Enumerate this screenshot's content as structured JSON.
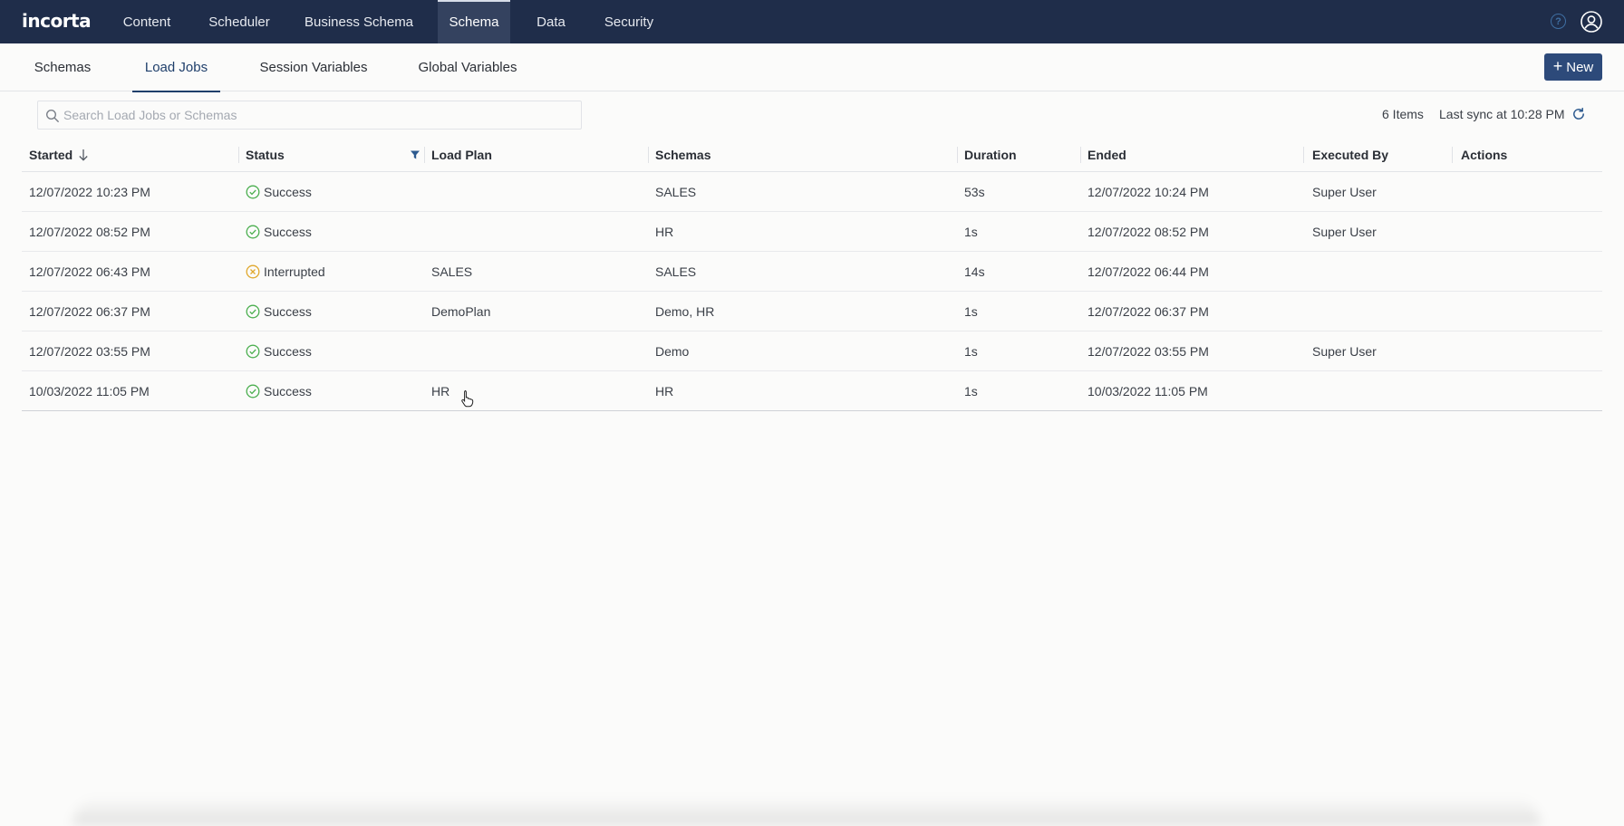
{
  "app": {
    "logo_text": "incorta"
  },
  "nav": {
    "items": [
      {
        "label": "Content"
      },
      {
        "label": "Scheduler"
      },
      {
        "label": "Business Schema"
      },
      {
        "label": "Schema",
        "active": true
      },
      {
        "label": "Data"
      },
      {
        "label": "Security"
      }
    ],
    "help_icon": "help-icon",
    "user_icon": "user-avatar-icon"
  },
  "subtabs": {
    "items": [
      {
        "label": "Schemas"
      },
      {
        "label": "Load Jobs",
        "active": true
      },
      {
        "label": "Session Variables"
      },
      {
        "label": "Global Variables"
      }
    ],
    "new_button": "New"
  },
  "toolbar": {
    "search_placeholder": "Search Load Jobs or Schemas",
    "search_value": "",
    "items_count": "6 Items",
    "last_sync": "Last sync at 10:28 PM"
  },
  "table": {
    "columns": [
      "Started",
      "Status",
      "Load Plan",
      "Schemas",
      "Duration",
      "Ended",
      "Executed By",
      "Actions"
    ],
    "rows": [
      {
        "started": "12/07/2022 10:23 PM",
        "status": "Success",
        "load_plan": "",
        "schemas": "SALES",
        "duration": "53s",
        "ended": "12/07/2022 10:24 PM",
        "executed_by": "Super User"
      },
      {
        "started": "12/07/2022 08:52 PM",
        "status": "Success",
        "load_plan": "",
        "schemas": "HR",
        "duration": "1s",
        "ended": "12/07/2022 08:52 PM",
        "executed_by": "Super User"
      },
      {
        "started": "12/07/2022 06:43 PM",
        "status": "Interrupted",
        "load_plan": "SALES",
        "schemas": "SALES",
        "duration": "14s",
        "ended": "12/07/2022 06:44 PM",
        "executed_by": ""
      },
      {
        "started": "12/07/2022 06:37 PM",
        "status": "Success",
        "load_plan": "DemoPlan",
        "schemas": "Demo, HR",
        "duration": "1s",
        "ended": "12/07/2022 06:37 PM",
        "executed_by": ""
      },
      {
        "started": "12/07/2022 03:55 PM",
        "status": "Success",
        "load_plan": "",
        "schemas": "Demo",
        "duration": "1s",
        "ended": "12/07/2022 03:55 PM",
        "executed_by": "Super User"
      },
      {
        "started": "10/03/2022 11:05 PM",
        "status": "Success",
        "load_plan": "HR",
        "schemas": "HR",
        "duration": "1s",
        "ended": "10/03/2022 11:05 PM",
        "executed_by": ""
      }
    ]
  },
  "colors": {
    "nav_bg": "#1f2d4a",
    "nav_active_bg": "#34425f",
    "accent": "#2d4a7a",
    "success": "#4caf50",
    "interrupted": "#e0a82e"
  }
}
